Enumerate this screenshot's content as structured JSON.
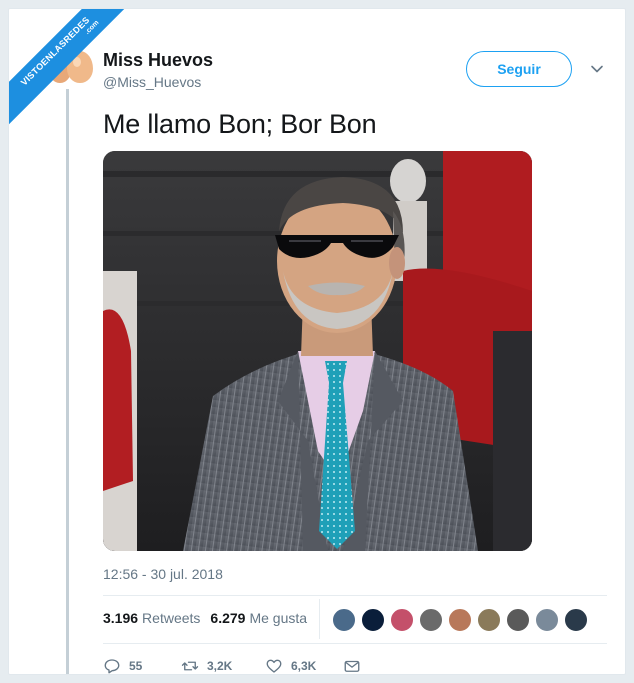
{
  "watermark": {
    "main": "VISTOENLASREDES",
    "sub": ".com"
  },
  "author": {
    "name": "Miss Huevos",
    "handle": "@Miss_Huevos",
    "avatar_icon": "eggs-avatar"
  },
  "follow_button": {
    "label": "Seguir"
  },
  "tweet": {
    "text": "Me llamo Bon; Bor Bon",
    "timestamp": "12:56 - 30 jul. 2018",
    "photo_icon": "photo-man-sunglasses-suit"
  },
  "stats": {
    "retweets_count": "3.196",
    "retweets_label": "Retweets",
    "likes_count": "6.279",
    "likes_label": "Me gusta",
    "liker_avatar_colors": [
      "#4a6a8a",
      "#0a1e3a",
      "#c4506a",
      "#6a6a6a",
      "#b8785a",
      "#8a7a5a",
      "#5a5a5a",
      "#7a8a9a",
      "#2a3a4a"
    ]
  },
  "actions": {
    "reply_count": "55",
    "retweet_count": "3,2K",
    "like_count": "6,3K"
  },
  "colors": {
    "accent": "#1da1f2",
    "text_secondary": "#657786",
    "watermark": "#1d8fe0"
  }
}
